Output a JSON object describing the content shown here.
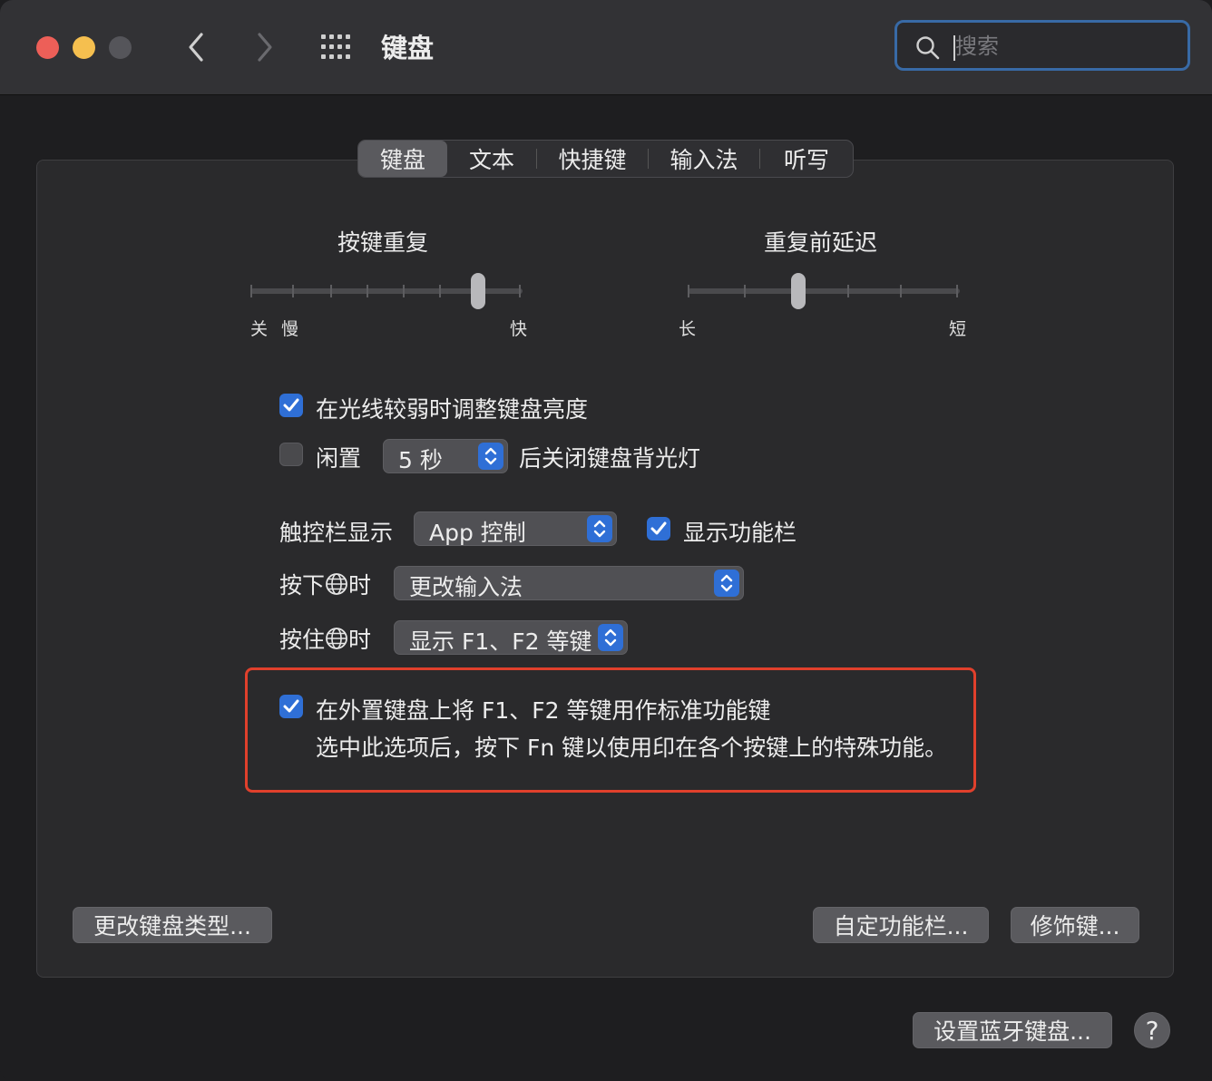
{
  "window": {
    "title": "键盘",
    "search_placeholder": "搜索"
  },
  "tabs": [
    {
      "label": "键盘",
      "active": true
    },
    {
      "label": "文本",
      "active": false
    },
    {
      "label": "快捷键",
      "active": false
    },
    {
      "label": "输入法",
      "active": false
    },
    {
      "label": "听写",
      "active": false
    }
  ],
  "key_repeat": {
    "label": "按键重复",
    "left1": "关",
    "left2": "慢",
    "right": "快",
    "level": 0.83
  },
  "repeat_delay": {
    "label": "重复前延迟",
    "left": "长",
    "right": "短",
    "level": 0.4
  },
  "options": {
    "adjust_brightness": {
      "label": "在光线较弱时调整键盘亮度",
      "checked": true
    },
    "idle": {
      "label": "闲置",
      "checked": false,
      "value": "5 秒",
      "suffix": "后关闭键盘背光灯"
    },
    "touchbar": {
      "label": "触控栏显示",
      "value": "App 控制",
      "show_fn_label": "显示功能栏",
      "show_fn_checked": true
    },
    "press_globe": {
      "label_pre": "按下",
      "label_post": "时",
      "value": "更改输入法"
    },
    "hold_globe": {
      "label_pre": "按住",
      "label_post": "时",
      "value": "显示 F1、F2 等键"
    },
    "use_fn_keys": {
      "label": "在外置键盘上将 F1、F2 等键用作标准功能键",
      "description": "选中此选项后，按下 Fn 键以使用印在各个按键上的特殊功能。",
      "checked": true
    }
  },
  "buttons": {
    "change_type": "更改键盘类型...",
    "customize_touchbar": "自定功能栏...",
    "modifier_keys": "修饰键...",
    "bluetooth": "设置蓝牙键盘...",
    "help": "?"
  },
  "colors": {
    "accent": "#2f6fd6",
    "highlight": "#e0402c"
  }
}
